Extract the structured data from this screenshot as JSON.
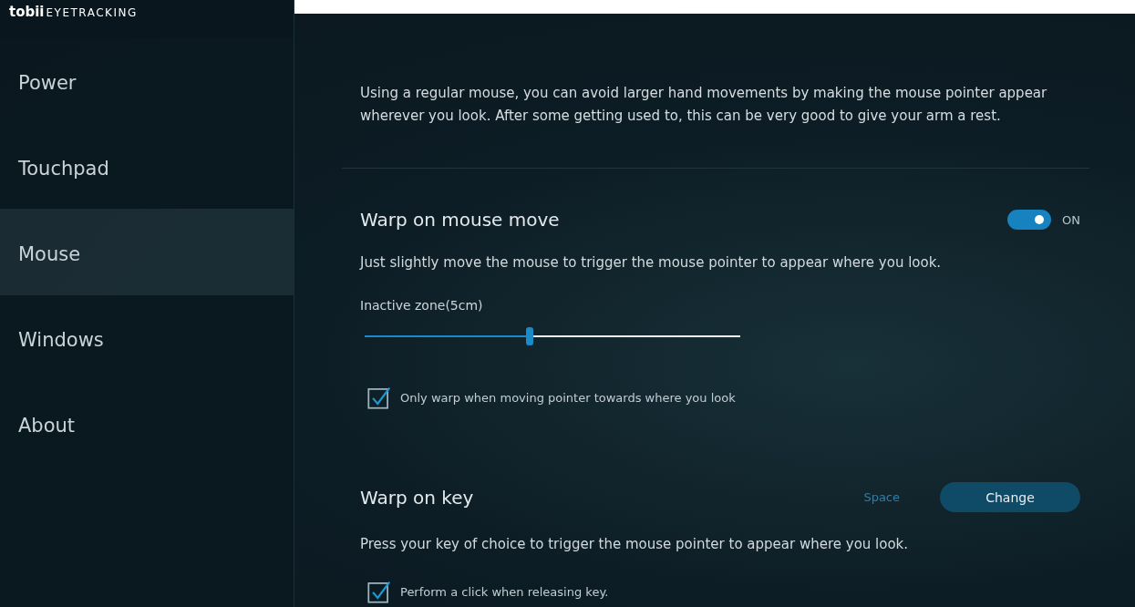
{
  "logo": {
    "brand": "tobii",
    "product": "EYETRACKING"
  },
  "sidebar": {
    "items": [
      {
        "label": "Power",
        "selected": false
      },
      {
        "label": "Touchpad",
        "selected": false
      },
      {
        "label": "Mouse",
        "selected": true
      },
      {
        "label": "Windows",
        "selected": false
      },
      {
        "label": "About",
        "selected": false
      }
    ]
  },
  "intro": "Using a regular mouse, you can avoid larger hand movements by making the mouse pointer appear wherever you look. After some getting used to, this can be very good to give your arm a rest.",
  "sections": [
    {
      "title": "Warp on mouse move",
      "toggle": {
        "on": true,
        "label": "ON"
      },
      "description": "Just slightly move the mouse to trigger the mouse pointer to appear where you look.",
      "slider": {
        "label": "Inactive zone(5cm)",
        "level": 0.44
      },
      "checkbox": {
        "label": "Only warp when moving pointer towards where you look",
        "checked": true
      }
    },
    {
      "title": "Warp on key",
      "key": {
        "value": "Space",
        "button": "Change"
      },
      "description": "Press your key of choice to trigger the mouse pointer to appear where you look.",
      "checkbox": {
        "label": "Perform a click when releasing key.",
        "checked": true
      }
    }
  ]
}
